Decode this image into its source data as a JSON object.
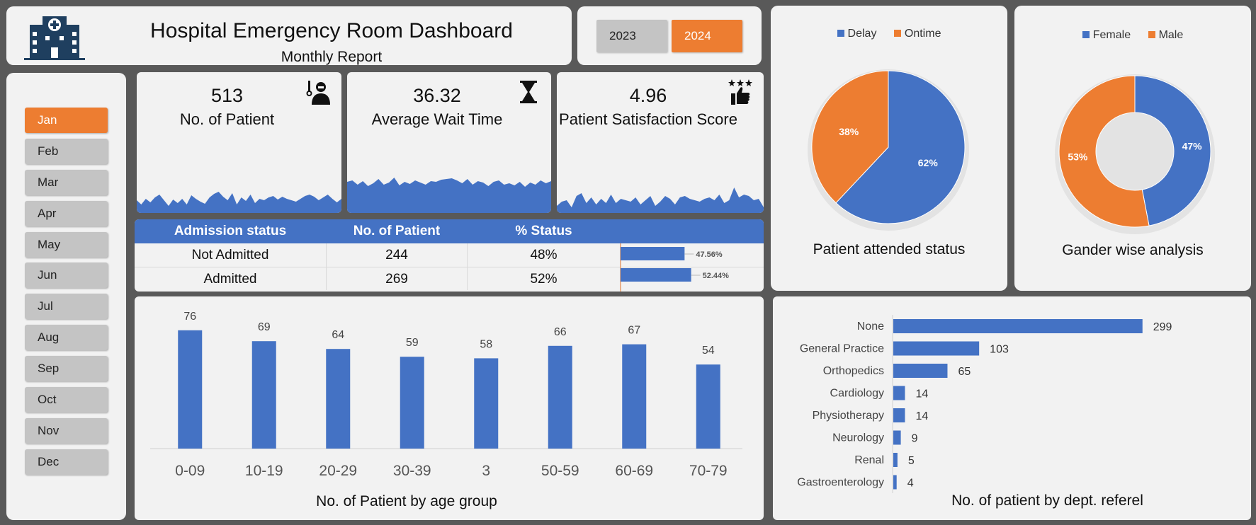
{
  "header": {
    "title": "Hospital Emergency Room Dashboard",
    "subtitle": "Monthly Report"
  },
  "years": [
    {
      "label": "2023",
      "active": false
    },
    {
      "label": "2024",
      "active": true
    }
  ],
  "months": [
    "Jan",
    "Feb",
    "Mar",
    "Apr",
    "May",
    "Jun",
    "Jul",
    "Aug",
    "Sep",
    "Oct",
    "Nov",
    "Dec"
  ],
  "active_month": "Jan",
  "kpis": {
    "patients": {
      "value": "513",
      "label": "No. of Patient",
      "icon": "doctor-patient-icon"
    },
    "wait": {
      "value": "36.32",
      "label": "Average Wait Time",
      "icon": "hourglass-icon"
    },
    "satisfaction": {
      "value": "4.96",
      "label": "Patient Satisfaction Score",
      "icon": "thumbs-up-stars-icon"
    }
  },
  "admission_table": {
    "headers": [
      "Admission status",
      "No. of Patient",
      "% Status"
    ],
    "rows": [
      {
        "status": "Not Admitted",
        "count": "244",
        "pct": "48%",
        "bar_label": "47.56%",
        "bar_value": 47.56
      },
      {
        "status": "Admitted",
        "count": "269",
        "pct": "52%",
        "bar_label": "52.44%",
        "bar_value": 52.44
      }
    ]
  },
  "colors": {
    "blue": "#4472c4",
    "orange": "#ed7d31",
    "panel": "#f2f2f2",
    "background": "#595959"
  },
  "chart_data": [
    {
      "type": "area",
      "name": "patients-sparkline",
      "values": [
        18,
        12,
        20,
        15,
        22,
        26,
        18,
        10,
        19,
        14,
        20,
        12,
        25,
        20,
        16,
        13,
        22,
        27,
        30,
        23,
        18,
        28,
        12,
        22,
        17,
        26,
        14,
        20,
        18,
        22,
        24,
        19,
        23,
        20,
        18,
        16,
        20,
        24,
        26,
        23,
        18,
        22,
        26,
        20,
        15,
        20
      ]
    },
    {
      "type": "area",
      "name": "wait-sparkline",
      "values": [
        44,
        46,
        40,
        45,
        38,
        42,
        48,
        40,
        43,
        50,
        39,
        44,
        41,
        46,
        43,
        40,
        45,
        44,
        47,
        48,
        49,
        46,
        42,
        48,
        40,
        45,
        43,
        38,
        44,
        46,
        40,
        42,
        39,
        44,
        37,
        43,
        40,
        46,
        42,
        45
      ]
    },
    {
      "type": "area",
      "name": "satisfaction-sparkline",
      "values": [
        10,
        16,
        18,
        8,
        24,
        28,
        14,
        22,
        12,
        20,
        14,
        26,
        14,
        20,
        18,
        16,
        22,
        12,
        18,
        24,
        10,
        16,
        24,
        20,
        12,
        22,
        24,
        20,
        18,
        16,
        20,
        22,
        18,
        26,
        14,
        18,
        36,
        22,
        26,
        24,
        18,
        20,
        8
      ]
    },
    {
      "type": "pie",
      "caption": "Patient attended status",
      "legend": [
        "Delay",
        "Ontime"
      ],
      "slices": [
        {
          "label": "Delay",
          "value": 62,
          "text": "62%"
        },
        {
          "label": "Ontime",
          "value": 38,
          "text": "38%"
        }
      ]
    },
    {
      "type": "pie",
      "donut": true,
      "caption": "Gander wise analysis",
      "legend": [
        "Female",
        "Male"
      ],
      "slices": [
        {
          "label": "Female",
          "value": 47,
          "text": "47%"
        },
        {
          "label": "Male",
          "value": 53,
          "text": "53%"
        }
      ]
    },
    {
      "type": "bar",
      "caption": "No. of Patient by age group",
      "categories": [
        "0-09",
        "10-19",
        "20-29",
        "30-39",
        "3",
        "50-59",
        "60-69",
        "70-79"
      ],
      "values": [
        76,
        69,
        64,
        59,
        58,
        66,
        67,
        54
      ],
      "ylim": [
        0,
        80
      ]
    },
    {
      "type": "bar",
      "orientation": "horizontal",
      "caption": "No. of patient by dept. referel",
      "categories": [
        "None",
        "General Practice",
        "Orthopedics",
        "Cardiology",
        "Physiotherapy",
        "Neurology",
        "Renal",
        "Gastroenterology"
      ],
      "values": [
        299,
        103,
        65,
        14,
        14,
        9,
        5,
        4
      ],
      "xlim": [
        0,
        340
      ]
    }
  ]
}
